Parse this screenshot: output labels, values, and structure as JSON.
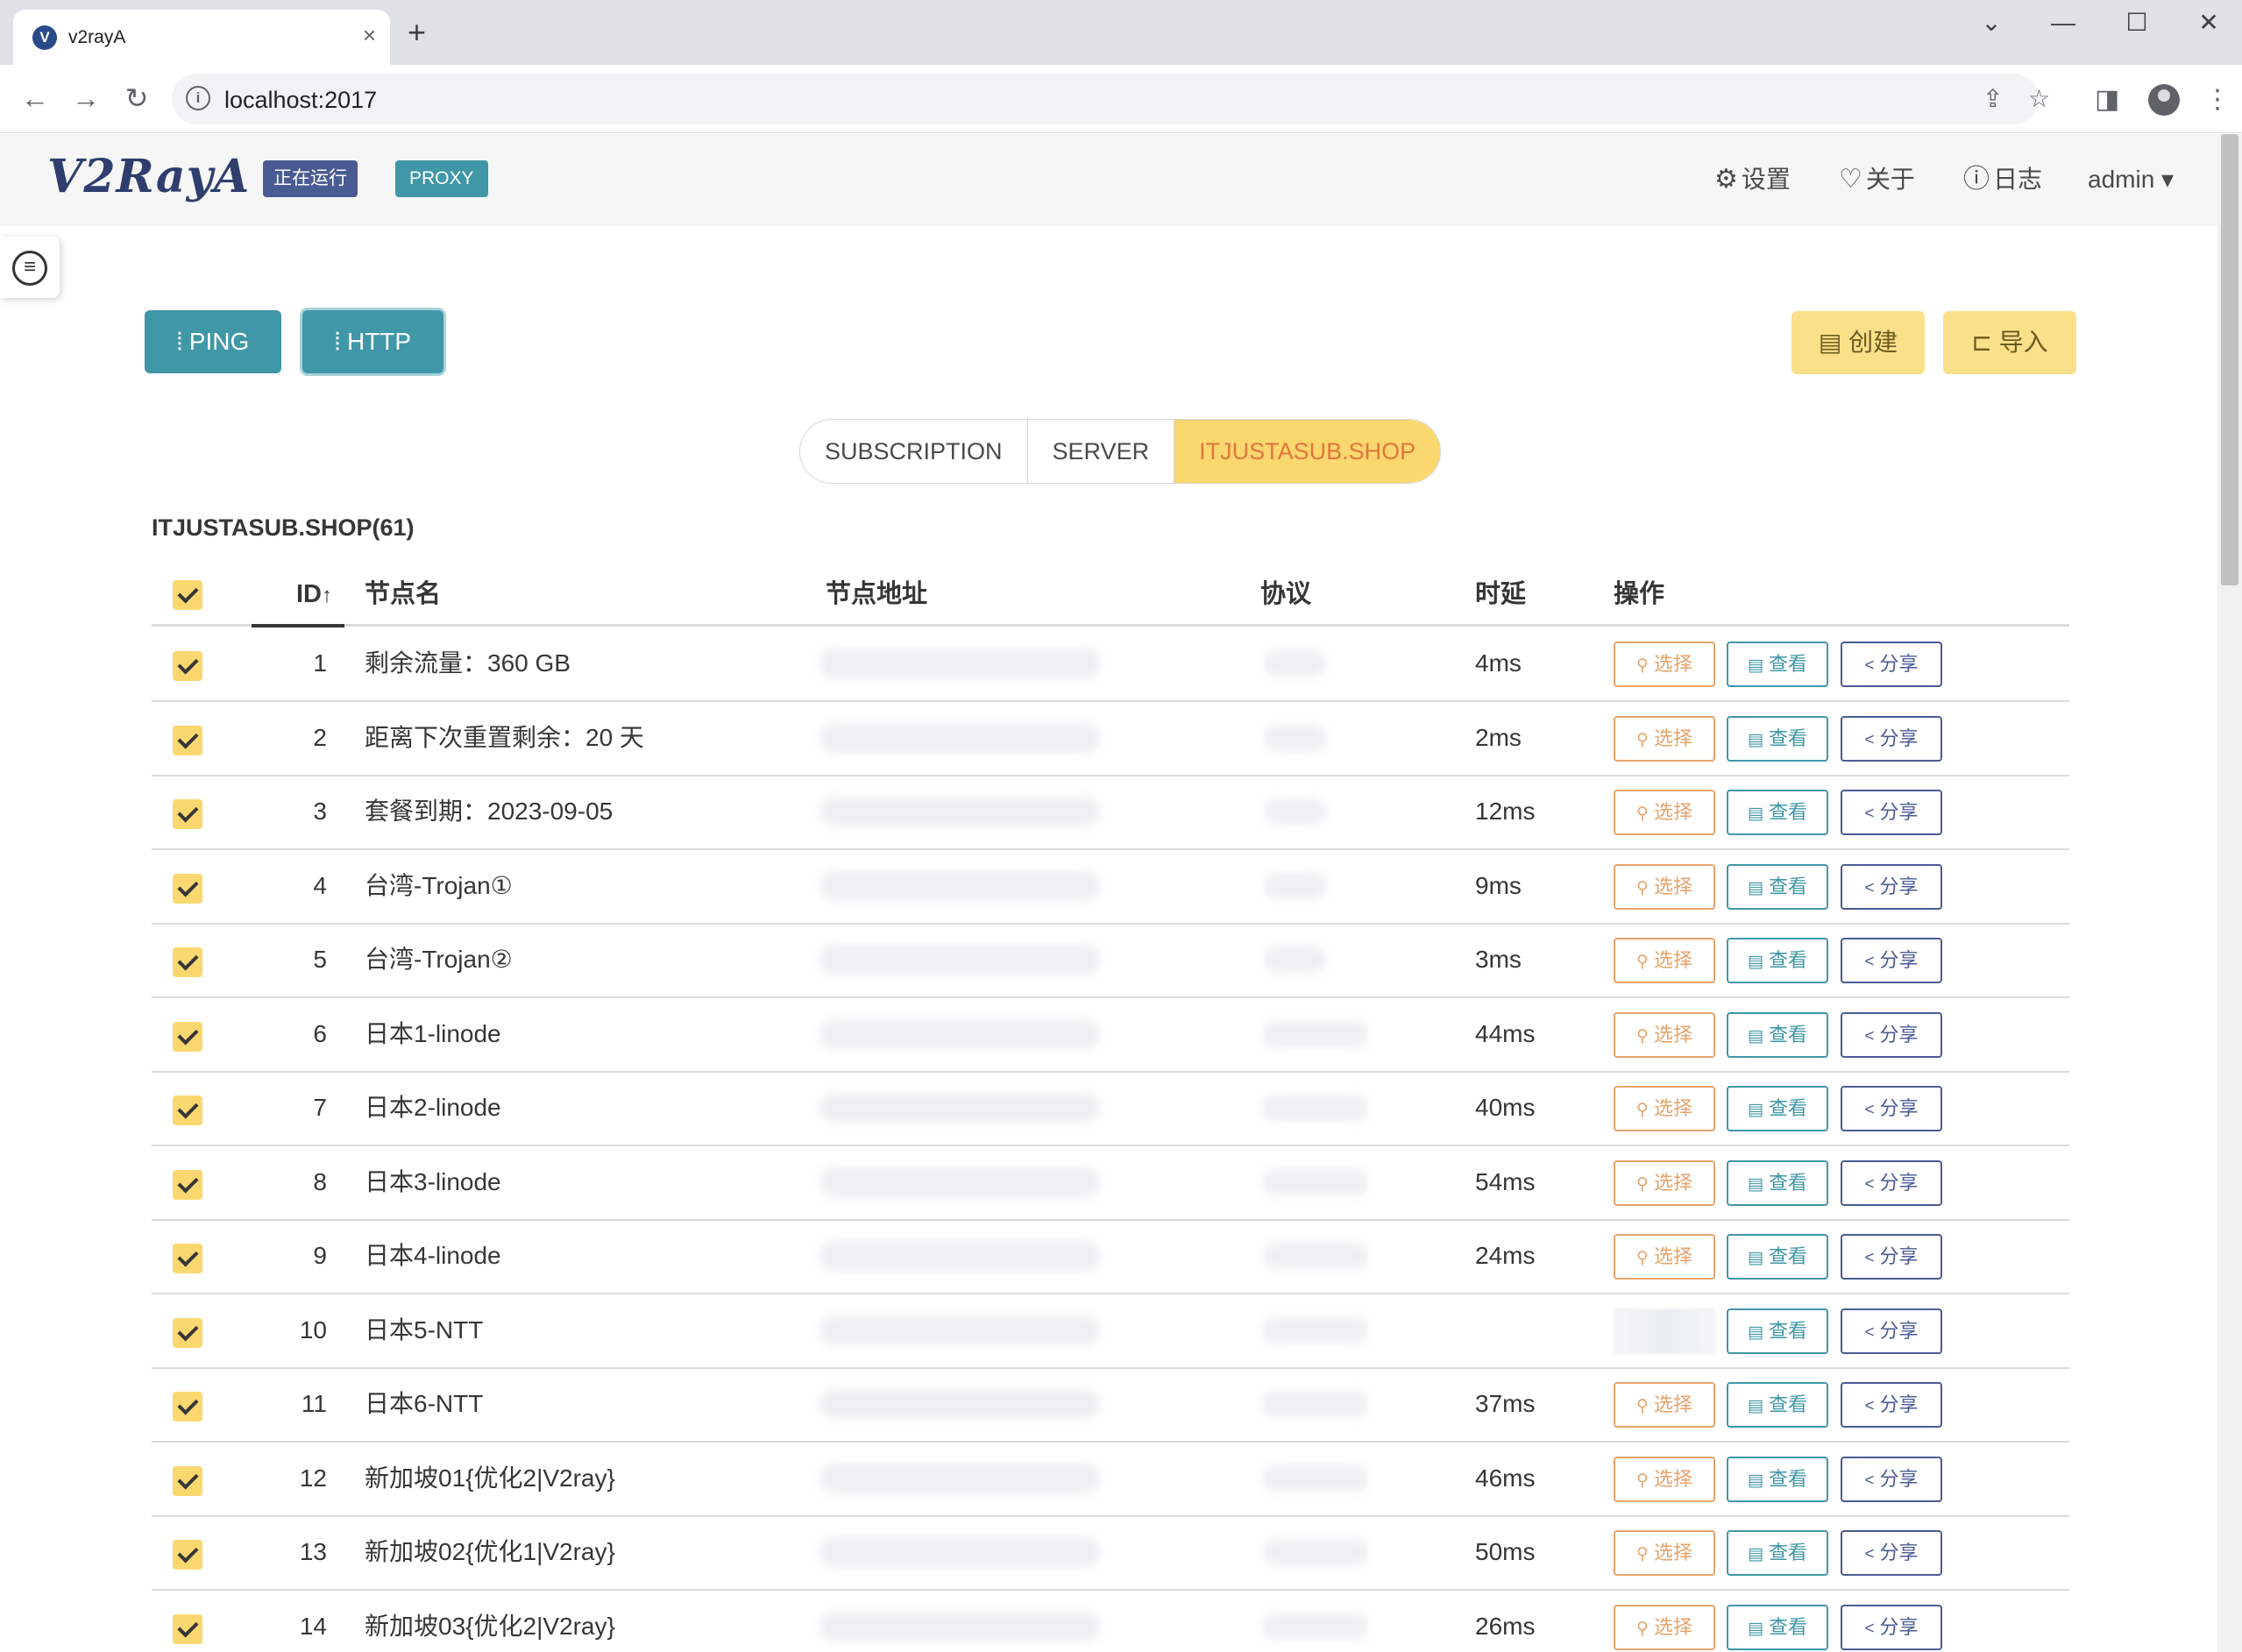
{
  "browser": {
    "tab_title": "v2rayA",
    "favicon": "V",
    "new_tab": "+",
    "tab_close": "×",
    "url": "localhost:2017",
    "window_controls": {
      "tabs_menu": "⌄",
      "minimize": "—",
      "maximize": "☐",
      "close": "✕"
    }
  },
  "app": {
    "logo": "V2RayA",
    "status_running": "正在运行",
    "status_proxy": "PROXY",
    "nav": {
      "settings": "设置",
      "about": "关于",
      "log": "日志",
      "user": "admin"
    }
  },
  "toolbar": {
    "ping": "PING",
    "http": "HTTP",
    "create": "创建",
    "import": "导入"
  },
  "tabs": [
    "SUBSCRIPTION",
    "SERVER",
    "ITJUSTASUB.SHOP"
  ],
  "group_title": "ITJUSTASUB.SHOP(61)",
  "table": {
    "headers": {
      "id": "ID",
      "name": "节点名",
      "address": "节点地址",
      "protocol": "协议",
      "latency": "时延",
      "actions": "操作"
    },
    "actions": {
      "select": "选择",
      "view": "查看",
      "share": "分享"
    },
    "rows": [
      {
        "id": "1",
        "name": "剩余流量：360 GB",
        "latency": "4ms"
      },
      {
        "id": "2",
        "name": "距离下次重置剩余：20 天",
        "latency": "2ms"
      },
      {
        "id": "3",
        "name": "套餐到期：2023-09-05",
        "latency": "12ms"
      },
      {
        "id": "4",
        "name": "台湾-Trojan①",
        "latency": "9ms"
      },
      {
        "id": "5",
        "name": "台湾-Trojan②",
        "latency": "3ms"
      },
      {
        "id": "6",
        "name": "日本1-linode",
        "latency": "44ms"
      },
      {
        "id": "7",
        "name": "日本2-linode",
        "latency": "40ms"
      },
      {
        "id": "8",
        "name": "日本3-linode",
        "latency": "54ms"
      },
      {
        "id": "9",
        "name": "日本4-linode",
        "latency": "24ms"
      },
      {
        "id": "10",
        "name": "日本5-NTT",
        "latency": ""
      },
      {
        "id": "11",
        "name": "日本6-NTT",
        "latency": "37ms"
      },
      {
        "id": "12",
        "name": "新加坡01{优化2|V2ray}",
        "latency": "46ms"
      },
      {
        "id": "13",
        "name": "新加坡02{优化1|V2ray}",
        "latency": "50ms"
      },
      {
        "id": "14",
        "name": "新加坡03{优化2|V2ray}",
        "latency": "26ms"
      }
    ]
  },
  "colors": {
    "teal": "#4097a7",
    "navy": "#4a5b93",
    "yellow": "#fbd76f",
    "orange": "#e7a36a"
  }
}
